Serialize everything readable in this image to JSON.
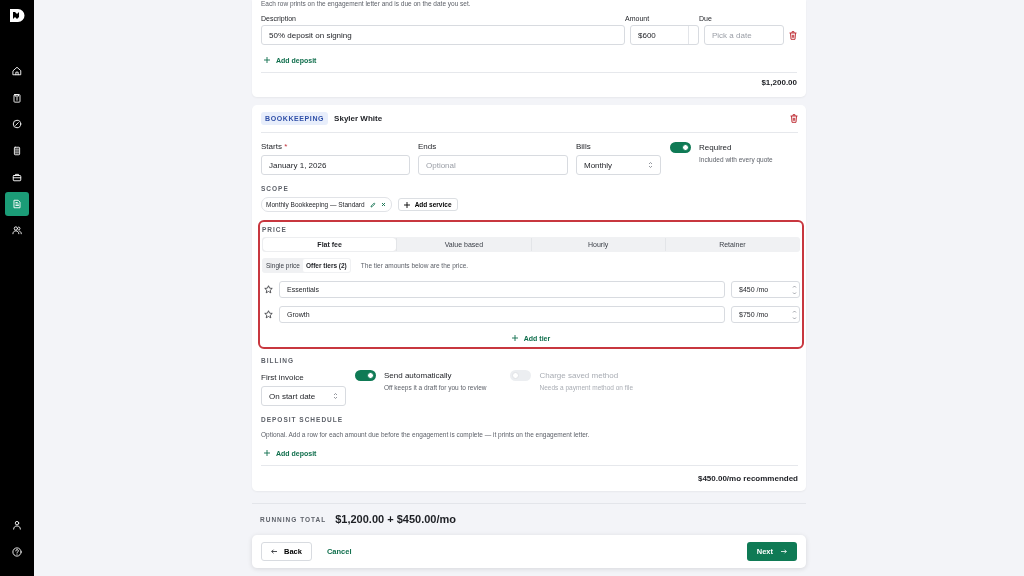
{
  "sidebar": {
    "items": [
      {
        "selected": false
      },
      {
        "selected": false
      },
      {
        "selected": false
      },
      {
        "selected": false
      },
      {
        "selected": false
      },
      {
        "selected": true
      },
      {
        "selected": false
      }
    ]
  },
  "deposit_card": {
    "note": "Each row prints on the engagement letter and is due on the date you set.",
    "columns": [
      "Description",
      "Amount",
      "Due"
    ],
    "rows": [
      {
        "description": "50% deposit on signing",
        "amount": "$600",
        "due_placeholder": "Pick a date"
      }
    ],
    "add_button": "Add deposit",
    "total": "$1,200.00"
  },
  "service": {
    "tag": "BOOKKEEPING",
    "client": "Skyler White",
    "starts": {
      "label": "Starts",
      "required_mark": "*",
      "value": "January 1, 2026"
    },
    "ends": {
      "label": "Ends",
      "placeholder": "Optional"
    },
    "bills": {
      "label": "Bills",
      "value": "Monthly"
    },
    "required_toggle": {
      "label": "Required",
      "hint": "Included with every quote",
      "on": true
    },
    "scope": {
      "heading": "SCOPE",
      "chips": [
        "Monthly Bookkeeping — Standard"
      ],
      "add_button": "Add service"
    },
    "price": {
      "heading": "PRICE",
      "highlighted": true,
      "tabs": [
        {
          "label": "Flat fee",
          "selected": true
        },
        {
          "label": "Value based",
          "selected": false
        },
        {
          "label": "Hourly",
          "selected": false
        },
        {
          "label": "Retainer",
          "selected": false
        }
      ],
      "modes": [
        {
          "label": "Single price",
          "selected": false
        },
        {
          "label": "Offer tiers (2)",
          "selected": true
        }
      ],
      "note": "The tier amounts below are the price.",
      "tiers": [
        {
          "name": "Essentials",
          "amount": "$450 /mo",
          "starred": false
        },
        {
          "name": "Growth",
          "amount": "$750 /mo",
          "starred": false
        }
      ],
      "add_button": "Add tier"
    },
    "billing": {
      "heading": "BILLING",
      "first_invoice": {
        "label": "First invoice",
        "value": "On start date"
      },
      "toggles": [
        {
          "label": "Send automatically",
          "hint": "Off keeps it a draft for you to review",
          "on": true,
          "disabled": false
        },
        {
          "label": "Charge saved method",
          "hint": "Needs a payment method on file",
          "on": false,
          "disabled": true
        }
      ]
    },
    "deposit_schedule": {
      "heading": "DEPOSIT SCHEDULE",
      "note": "Optional. Add a row for each amount due before the engagement is complete — it prints on the engagement letter.",
      "add_button": "Add deposit"
    },
    "total": "$450.00/mo recommended"
  },
  "running_total": {
    "label": "RUNNING TOTAL",
    "value": "$1,200.00 + $450.00/mo"
  },
  "footer": {
    "back": "Back",
    "cancel": "Cancel",
    "next": "Next"
  }
}
